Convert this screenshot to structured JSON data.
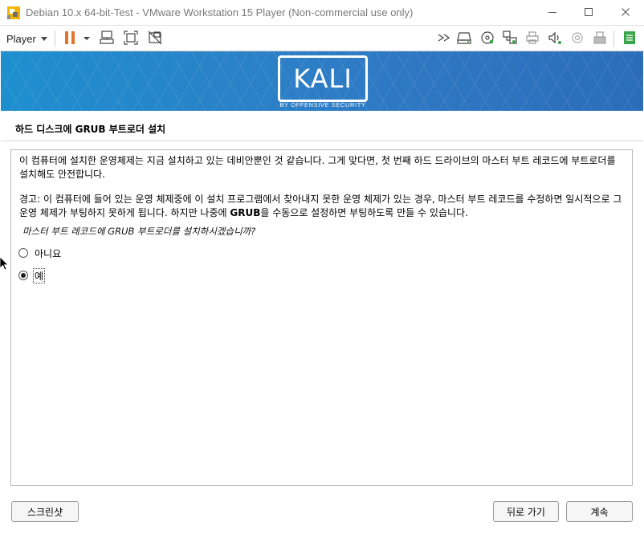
{
  "window": {
    "title": "Debian 10.x 64-bit-Test - VMware Workstation 15 Player (Non-commercial use only)",
    "icon": "vmware-player-icon",
    "controls": [
      "minimize-icon",
      "maximize-icon",
      "close-icon"
    ]
  },
  "toolbar": {
    "player_label": "Player",
    "icons": [
      "pause-icon",
      "dropdown-arrow-icon",
      "send-ctrl-alt-del-icon",
      "fit-guest-icon",
      "unity-mode-icon",
      "fast-forward-icon",
      "hard-disk-icon",
      "cd-dvd-icon",
      "network-adapter-icon",
      "printer-icon",
      "sound-card-icon",
      "camera-icon",
      "usb-device-icon",
      "message-log-icon"
    ],
    "accent_pause": "#e3762b",
    "accent_log": "#3aa64a"
  },
  "banner": {
    "logo_text": "KALI",
    "tagline": "BY OFFENSIVE SECURITY",
    "color": "#2a82c8"
  },
  "installer": {
    "heading": "하드 디스크에 GRUB 부트로더 설치",
    "paragraph1": "이 컴퓨터에 설치한 운영체제는 지금 설치하고 있는 데비안뿐인 것 같습니다. 그게 맞다면, 첫 번째 하드 드라이브의 마스터 부트 레코드에 부트로더를 설치해도 안전합니다.",
    "paragraph2_prefix": "경고: 이 컴퓨터에 들어 있는 운영 체제중에 이 설치 프로그램에서 찾아내지 못한 운영 체제가 있는 경우, 마스터 부트 레코드를 수정하면 일시적으로 그 운영 체제가 부팅하지 못하게 됩니다. 하지만 나중에 ",
    "paragraph2_bold": "GRUB",
    "paragraph2_suffix": "을 수동으로 설정하면 부팅하도록 만들 수 있습니다.",
    "question": "마스터 부트 레코드에 GRUB 부트로더를 설치하시겠습니까?",
    "options": [
      {
        "label": "아니요",
        "selected": false
      },
      {
        "label": "예",
        "selected": true
      }
    ]
  },
  "buttons": {
    "screenshot": "스크린샷",
    "back": "뒤로 가기",
    "continue": "계속"
  }
}
